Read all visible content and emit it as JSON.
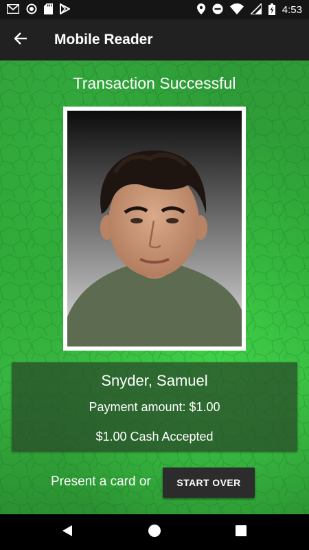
{
  "status_bar": {
    "time": "4:53",
    "left_icons": [
      "gmail-icon",
      "circle-notification-icon",
      "sd-card-icon",
      "play-store-icon"
    ],
    "right_icons": [
      "location-icon",
      "do-not-disturb-icon",
      "wifi-icon",
      "signal-icon",
      "battery-charging-icon"
    ]
  },
  "app_bar": {
    "title": "Mobile Reader",
    "back_icon": "arrow-back-icon"
  },
  "main": {
    "headline": "Transaction Successful",
    "photo_alt": "Cardholder photo",
    "cardholder_name": "Snyder, Samuel",
    "payment_amount": "Payment amount: $1.00",
    "cash_status": "$1.00 Cash Accepted",
    "prompt": "Present a card or",
    "start_over_label": "START OVER"
  },
  "nav_bar": {
    "icons": [
      "back-triangle-icon",
      "home-circle-icon",
      "recents-square-icon"
    ]
  },
  "colors": {
    "status_bar": "#151515",
    "app_bar": "#212121",
    "background_green": "#2ea537",
    "panel": "#2c462c",
    "button": "#2c2c2c"
  }
}
